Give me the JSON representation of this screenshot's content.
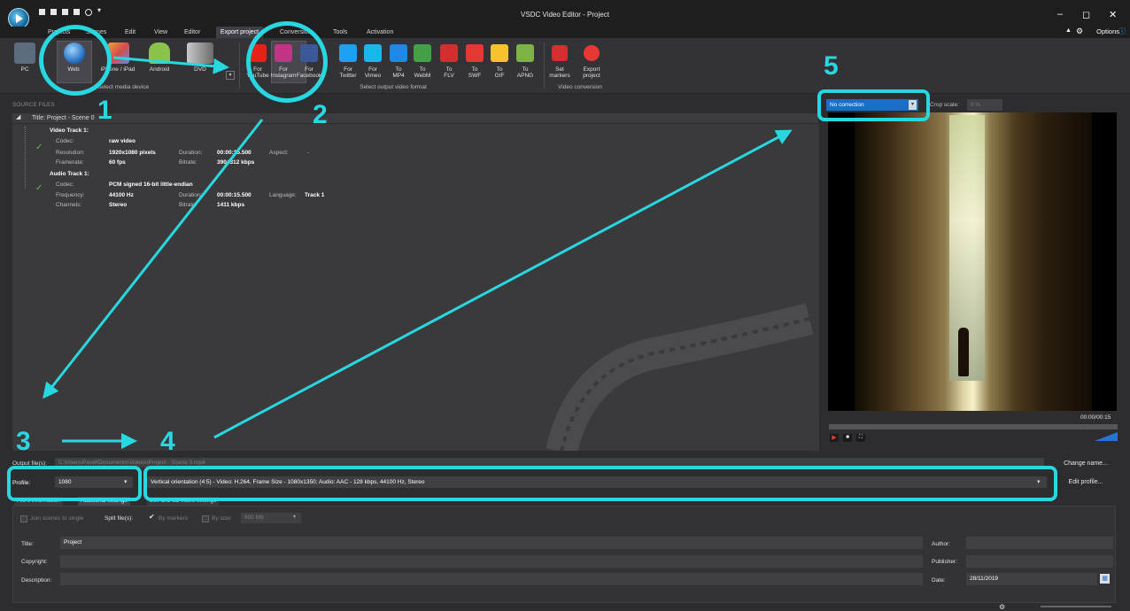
{
  "window": {
    "title": "VSDC Video Editor - Project",
    "minimize": "–",
    "maximize": "◻",
    "close": "✕"
  },
  "menu": {
    "items": [
      "Projects",
      "Scenes",
      "Edit",
      "View",
      "Editor",
      "Export project",
      "Conversion",
      "Tools",
      "Activation"
    ],
    "options": "Options"
  },
  "ribbon": {
    "device_buttons": [
      "PC",
      "Web",
      "iPhone / iPad",
      "Android",
      "DVD"
    ],
    "device_group": "Select media device",
    "format_buttons": [
      {
        "label": "For\nYouTube",
        "icon": "youtube-icon",
        "color": "#e62117"
      },
      {
        "label": "For\nInstagram",
        "icon": "instagram-icon",
        "color": "#c13584"
      },
      {
        "label": "For\nFacebook",
        "icon": "facebook-icon",
        "color": "#3b5998"
      },
      {
        "label": "For\nTwitter",
        "icon": "twitter-icon",
        "color": "#1da1f2"
      },
      {
        "label": "For\nVimeo",
        "icon": "vimeo-icon",
        "color": "#1ab7ea"
      },
      {
        "label": "To\nMP4",
        "icon": "mp4-icon",
        "color": "#1e88e5"
      },
      {
        "label": "To\nWebM",
        "icon": "webm-icon",
        "color": "#43a047"
      },
      {
        "label": "To\nFLV",
        "icon": "flv-icon",
        "color": "#d32f2f"
      },
      {
        "label": "To\nSWF",
        "icon": "swf-icon",
        "color": "#e53935"
      },
      {
        "label": "To\nGIF",
        "icon": "gif-icon",
        "color": "#fbc02d"
      },
      {
        "label": "To\nAPNG",
        "icon": "apng-icon",
        "color": "#7cb342"
      }
    ],
    "format_group": "Select output video format",
    "conversion_buttons": [
      {
        "label": "Set\nmarkers",
        "icon": "marker-icon",
        "color": "#d32f2f"
      },
      {
        "label": "Export\nproject",
        "icon": "export-icon",
        "color": "#e53935"
      }
    ],
    "conversion_group": "Video conversion"
  },
  "source": {
    "header": "SOURCE FILES",
    "scene_title": "Title: Project - Scene 0",
    "video_track": "Video Track 1:",
    "codec_label": "Codec:",
    "codec": "raw video",
    "resolution_label": "Resolution:",
    "resolution": "1920x1080 pixels",
    "duration_label": "Duration:",
    "duration": "00:00:15.500",
    "aspect_label": "Aspect:",
    "aspect": "-",
    "framerate_label": "Framerate:",
    "framerate": "60 fps",
    "bitrate_label": "Bitrate:",
    "bitrate": "3904312 kbps",
    "audio_track": "Audio Track 1:",
    "acodec": "PCM signed 16-bit little-endian",
    "frequency_label": "Frequency:",
    "frequency": "44100 Hz",
    "aduration": "00:00:15.500",
    "language_label": "Language:",
    "language": "Track 1",
    "channels_label": "Channels:",
    "channels": "Stereo",
    "abitrate": "1411 kbps"
  },
  "preview": {
    "correction": "No correction",
    "crop_label": "Crop scale:",
    "crop_value": "0 %",
    "timecode": "00:00/00:15"
  },
  "output": {
    "label": "Output file(s):",
    "path": "C:\\Users\\Pavel\\Documents\\Videos\\Project - Scene 0.mp4",
    "change_name": "Change name...",
    "profile_label": "Profile:",
    "profile": "1080",
    "profile_desc": "Vertical orientation (4:5) - Video: H.264, Frame Size - 1080x1350; Audio: AAC - 128 kbps, 44100 Hz, Stereo",
    "edit_profile": "Edit profile..."
  },
  "tabs": [
    "File's information",
    "Additional settings",
    "360 and 3D video settings"
  ],
  "settings": {
    "join_scenes": "Join scenes to single",
    "split_label": "Split file(s):",
    "by_markers": "By markers",
    "by_size": "By size:",
    "size_value": "600 Mb",
    "title_label": "Title:",
    "title": "Project",
    "author_label": "Author:",
    "author": "",
    "copyright_label": "Copyright:",
    "copyright": "",
    "publisher_label": "Publisher:",
    "publisher": "",
    "description_label": "Description:",
    "description": "",
    "date_label": "Date:",
    "date": "28/11/2019"
  },
  "annotations": {
    "n1": "1",
    "n2": "2",
    "n3": "3",
    "n4": "4",
    "n5": "5",
    "color": "#27d8e0"
  }
}
